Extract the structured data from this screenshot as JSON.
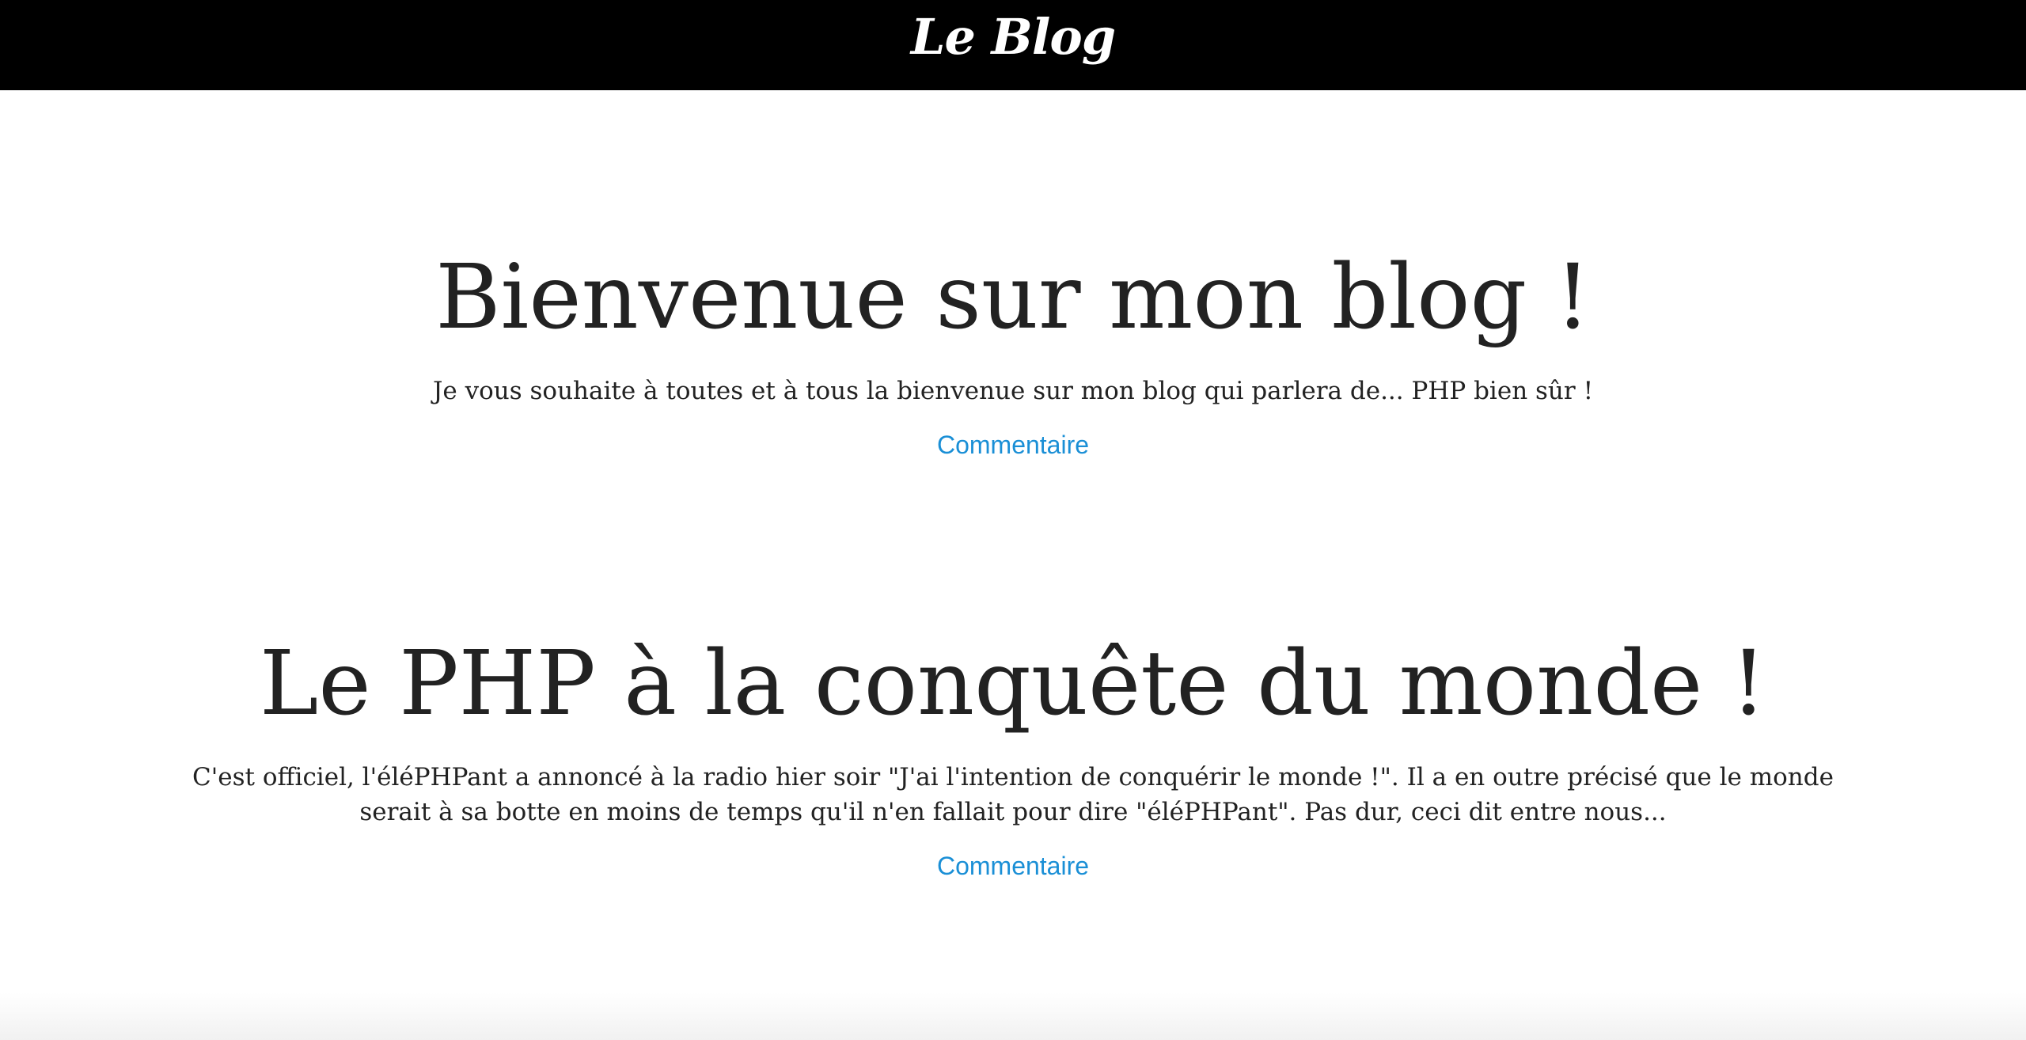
{
  "header": {
    "site_title": "Le Blog"
  },
  "posts": [
    {
      "title": "Bienvenue sur mon blog !",
      "excerpt": "Je vous souhaite à toutes et à tous la bienvenue sur mon blog qui parlera de... PHP bien sûr !",
      "comment_label": "Commentaire"
    },
    {
      "title": "Le PHP à la conquête du monde !",
      "excerpt": "C'est officiel, l'éléPHPant a annoncé à la radio hier soir \"J'ai l'intention de conquérir le monde !\". Il a en outre précisé que le monde serait à sa botte en moins de temps qu'il n'en fallait pour dire \"éléPHPant\". Pas dur, ceci dit entre nous...",
      "comment_label": "Commentaire"
    }
  ],
  "colors": {
    "header_bg": "#000000",
    "header_text": "#ffffff",
    "title_text": "#222222",
    "link": "#1a8fd6"
  }
}
